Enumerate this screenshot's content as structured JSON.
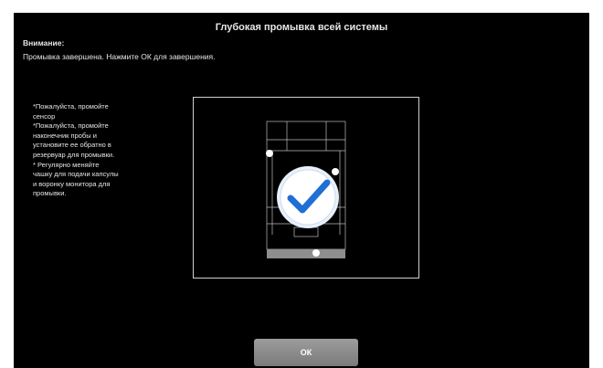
{
  "dialog": {
    "title": "Глубокая промывка всей системы",
    "warning_label": "Внимание:",
    "warning_message": "Промывка завершена. Нажмите ОК для завершения."
  },
  "instructions": [
    "*Пожалуйста, промойте",
    "сенсор",
    "*Пожалуйста, промойте",
    "наконечник пробы и",
    "установите ее обратно в",
    "резервуар для промывки.",
    "* Регулярно меняйте",
    "чашку для подачи капсулы",
    "и воронку монитора для",
    "промывки."
  ],
  "diagram": {
    "status": "complete",
    "icon": "checkmark-icon",
    "accent_color": "#1f6fd6"
  },
  "buttons": {
    "ok_label": "ОК"
  }
}
